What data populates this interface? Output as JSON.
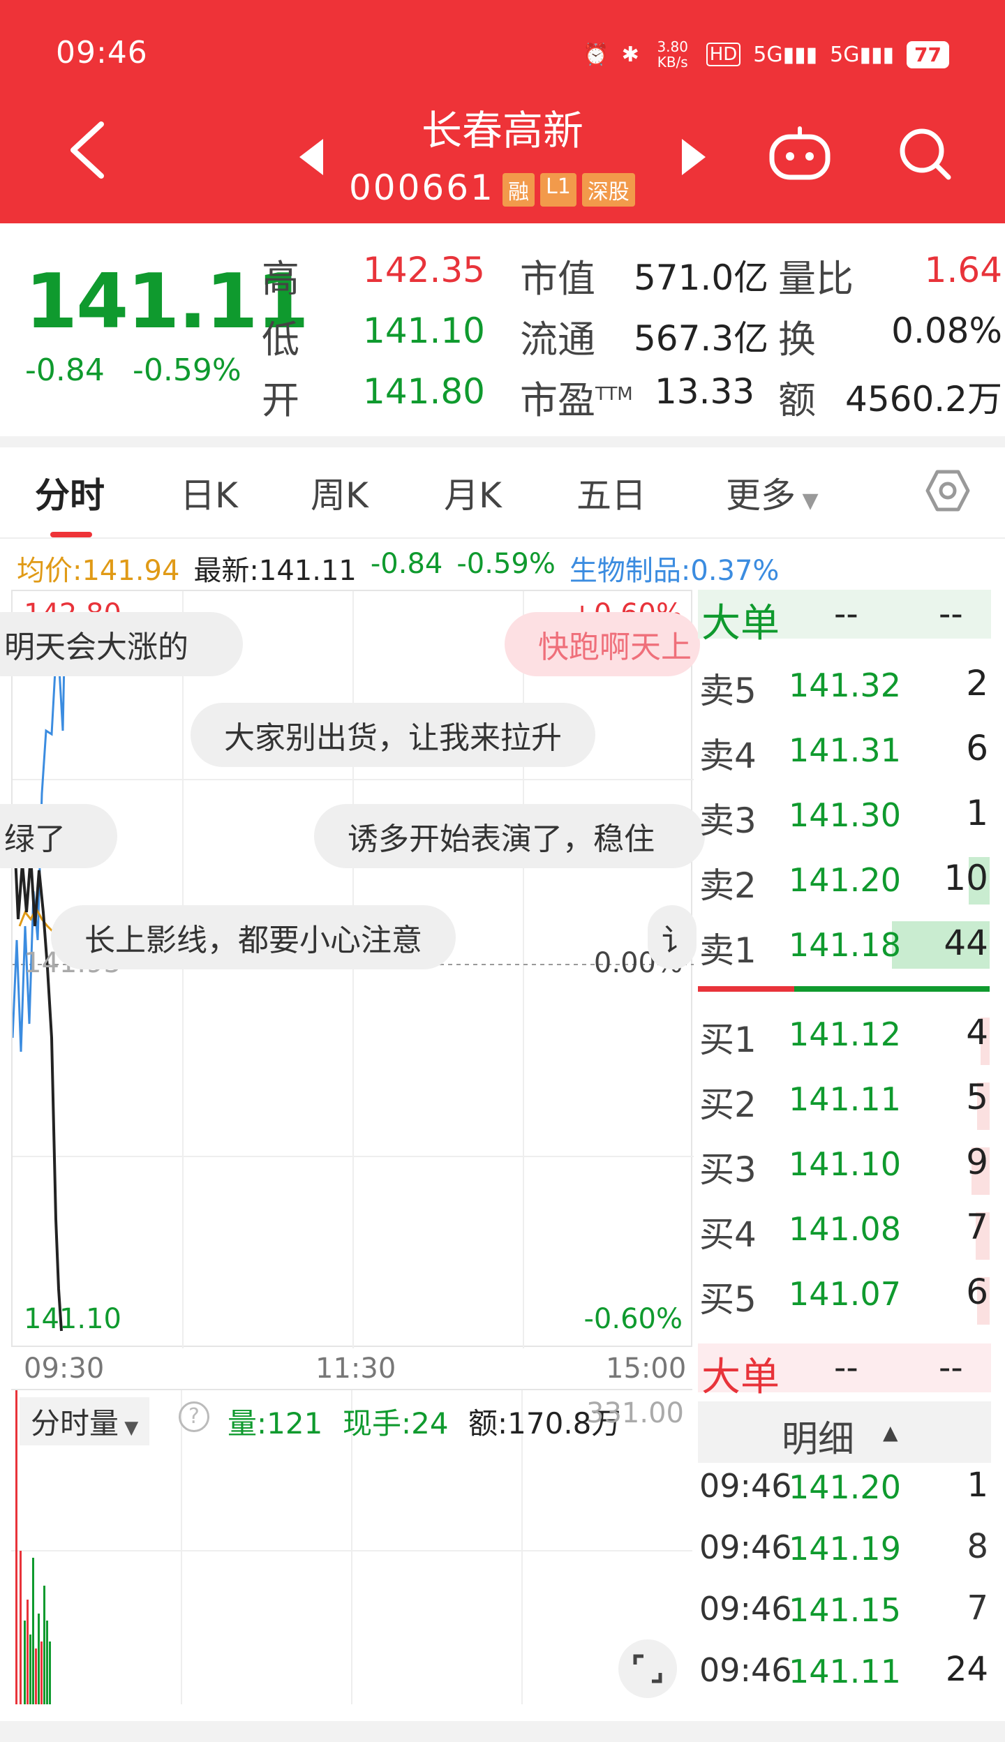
{
  "status_bar": {
    "time": "09:46",
    "net_speed": "3.80 KB/s",
    "battery": "77"
  },
  "header": {
    "stock_name": "长春高新",
    "stock_code": "000661",
    "tags": [
      "融",
      "L1",
      "深股"
    ]
  },
  "quote": {
    "price": "141.11",
    "change": "-0.84",
    "change_pct": "-0.59%",
    "high_label": "高",
    "high": "142.35",
    "low_label": "低",
    "low": "141.10",
    "open_label": "开",
    "open": "141.80",
    "mktcap_label": "市值",
    "mktcap": "571.0亿",
    "float_label": "流通",
    "float": "567.3亿",
    "pe_label": "市盈",
    "pe_sup": "TTM",
    "pe": "13.33",
    "volratio_label": "量比",
    "volratio": "1.64",
    "turnover_label": "换",
    "turnover": "0.08%",
    "amount_label": "额",
    "amount": "4560.2万"
  },
  "tabs": [
    "分时",
    "日K",
    "周K",
    "月K",
    "五日",
    "更多"
  ],
  "info_line": {
    "avg": "均价:141.94",
    "latest": "最新:141.11",
    "change": "-0.84",
    "pct": "-0.59%",
    "sector": "生物制品:0.37%"
  },
  "chart": {
    "y_top_left": "142.80",
    "y_top_right": "+0.60%",
    "y_mid_left": "141.95",
    "y_mid_right": "0.00%",
    "y_bottom_left": "141.10",
    "y_bottom_right": "-0.60%",
    "x_labels": [
      "09:30",
      "11:30",
      "15:00"
    ]
  },
  "danmaku": [
    "明天会大涨的",
    "快跑啊天上",
    "大家别出货，让我来拉升",
    "绿了",
    "诱多开始表演了，稳住",
    "长上影线，都要小心注意",
    "讠"
  ],
  "volume": {
    "selector": "分时量",
    "vol": "量:121",
    "hand": "现手:24",
    "amt": "额:170.8万",
    "max": "331.00"
  },
  "orderbook": {
    "big_title": "大单",
    "big_a": "--",
    "big_b": "--",
    "asks": [
      {
        "label": "卖5",
        "price": "141.32",
        "vol": "2"
      },
      {
        "label": "卖4",
        "price": "141.31",
        "vol": "6"
      },
      {
        "label": "卖3",
        "price": "141.30",
        "vol": "1"
      },
      {
        "label": "卖2",
        "price": "141.20",
        "vol": "10"
      },
      {
        "label": "卖1",
        "price": "141.18",
        "vol": "44"
      }
    ],
    "bids": [
      {
        "label": "买1",
        "price": "141.12",
        "vol": "4"
      },
      {
        "label": "买2",
        "price": "141.11",
        "vol": "5"
      },
      {
        "label": "买3",
        "price": "141.10",
        "vol": "9"
      },
      {
        "label": "买4",
        "price": "141.08",
        "vol": "7"
      },
      {
        "label": "买5",
        "price": "141.07",
        "vol": "6"
      }
    ],
    "big2_title": "大单",
    "big2_a": "--",
    "big2_b": "--",
    "detail_title": "明细",
    "trades": [
      {
        "time": "09:46",
        "price": "141.20",
        "vol": "1"
      },
      {
        "time": "09:46",
        "price": "141.19",
        "vol": "8"
      },
      {
        "time": "09:46",
        "price": "141.15",
        "vol": "7"
      },
      {
        "time": "09:46",
        "price": "141.11",
        "vol": "24"
      }
    ]
  }
}
